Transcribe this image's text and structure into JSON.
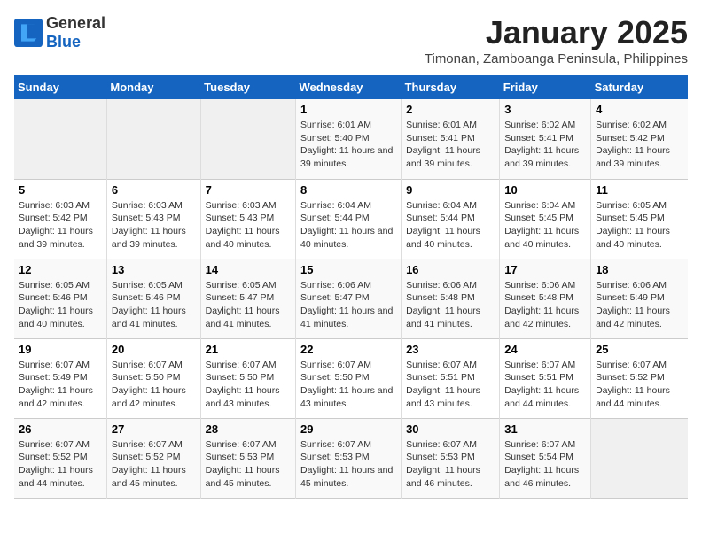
{
  "header": {
    "logo_general": "General",
    "logo_blue": "Blue",
    "month": "January 2025",
    "location": "Timonan, Zamboanga Peninsula, Philippines"
  },
  "weekdays": [
    "Sunday",
    "Monday",
    "Tuesday",
    "Wednesday",
    "Thursday",
    "Friday",
    "Saturday"
  ],
  "weeks": [
    [
      {
        "day": "",
        "empty": true
      },
      {
        "day": "",
        "empty": true
      },
      {
        "day": "",
        "empty": true
      },
      {
        "day": "1",
        "sunrise": "Sunrise: 6:01 AM",
        "sunset": "Sunset: 5:40 PM",
        "daylight": "Daylight: 11 hours and 39 minutes."
      },
      {
        "day": "2",
        "sunrise": "Sunrise: 6:01 AM",
        "sunset": "Sunset: 5:41 PM",
        "daylight": "Daylight: 11 hours and 39 minutes."
      },
      {
        "day": "3",
        "sunrise": "Sunrise: 6:02 AM",
        "sunset": "Sunset: 5:41 PM",
        "daylight": "Daylight: 11 hours and 39 minutes."
      },
      {
        "day": "4",
        "sunrise": "Sunrise: 6:02 AM",
        "sunset": "Sunset: 5:42 PM",
        "daylight": "Daylight: 11 hours and 39 minutes."
      }
    ],
    [
      {
        "day": "5",
        "sunrise": "Sunrise: 6:03 AM",
        "sunset": "Sunset: 5:42 PM",
        "daylight": "Daylight: 11 hours and 39 minutes."
      },
      {
        "day": "6",
        "sunrise": "Sunrise: 6:03 AM",
        "sunset": "Sunset: 5:43 PM",
        "daylight": "Daylight: 11 hours and 39 minutes."
      },
      {
        "day": "7",
        "sunrise": "Sunrise: 6:03 AM",
        "sunset": "Sunset: 5:43 PM",
        "daylight": "Daylight: 11 hours and 40 minutes."
      },
      {
        "day": "8",
        "sunrise": "Sunrise: 6:04 AM",
        "sunset": "Sunset: 5:44 PM",
        "daylight": "Daylight: 11 hours and 40 minutes."
      },
      {
        "day": "9",
        "sunrise": "Sunrise: 6:04 AM",
        "sunset": "Sunset: 5:44 PM",
        "daylight": "Daylight: 11 hours and 40 minutes."
      },
      {
        "day": "10",
        "sunrise": "Sunrise: 6:04 AM",
        "sunset": "Sunset: 5:45 PM",
        "daylight": "Daylight: 11 hours and 40 minutes."
      },
      {
        "day": "11",
        "sunrise": "Sunrise: 6:05 AM",
        "sunset": "Sunset: 5:45 PM",
        "daylight": "Daylight: 11 hours and 40 minutes."
      }
    ],
    [
      {
        "day": "12",
        "sunrise": "Sunrise: 6:05 AM",
        "sunset": "Sunset: 5:46 PM",
        "daylight": "Daylight: 11 hours and 40 minutes."
      },
      {
        "day": "13",
        "sunrise": "Sunrise: 6:05 AM",
        "sunset": "Sunset: 5:46 PM",
        "daylight": "Daylight: 11 hours and 41 minutes."
      },
      {
        "day": "14",
        "sunrise": "Sunrise: 6:05 AM",
        "sunset": "Sunset: 5:47 PM",
        "daylight": "Daylight: 11 hours and 41 minutes."
      },
      {
        "day": "15",
        "sunrise": "Sunrise: 6:06 AM",
        "sunset": "Sunset: 5:47 PM",
        "daylight": "Daylight: 11 hours and 41 minutes."
      },
      {
        "day": "16",
        "sunrise": "Sunrise: 6:06 AM",
        "sunset": "Sunset: 5:48 PM",
        "daylight": "Daylight: 11 hours and 41 minutes."
      },
      {
        "day": "17",
        "sunrise": "Sunrise: 6:06 AM",
        "sunset": "Sunset: 5:48 PM",
        "daylight": "Daylight: 11 hours and 42 minutes."
      },
      {
        "day": "18",
        "sunrise": "Sunrise: 6:06 AM",
        "sunset": "Sunset: 5:49 PM",
        "daylight": "Daylight: 11 hours and 42 minutes."
      }
    ],
    [
      {
        "day": "19",
        "sunrise": "Sunrise: 6:07 AM",
        "sunset": "Sunset: 5:49 PM",
        "daylight": "Daylight: 11 hours and 42 minutes."
      },
      {
        "day": "20",
        "sunrise": "Sunrise: 6:07 AM",
        "sunset": "Sunset: 5:50 PM",
        "daylight": "Daylight: 11 hours and 42 minutes."
      },
      {
        "day": "21",
        "sunrise": "Sunrise: 6:07 AM",
        "sunset": "Sunset: 5:50 PM",
        "daylight": "Daylight: 11 hours and 43 minutes."
      },
      {
        "day": "22",
        "sunrise": "Sunrise: 6:07 AM",
        "sunset": "Sunset: 5:50 PM",
        "daylight": "Daylight: 11 hours and 43 minutes."
      },
      {
        "day": "23",
        "sunrise": "Sunrise: 6:07 AM",
        "sunset": "Sunset: 5:51 PM",
        "daylight": "Daylight: 11 hours and 43 minutes."
      },
      {
        "day": "24",
        "sunrise": "Sunrise: 6:07 AM",
        "sunset": "Sunset: 5:51 PM",
        "daylight": "Daylight: 11 hours and 44 minutes."
      },
      {
        "day": "25",
        "sunrise": "Sunrise: 6:07 AM",
        "sunset": "Sunset: 5:52 PM",
        "daylight": "Daylight: 11 hours and 44 minutes."
      }
    ],
    [
      {
        "day": "26",
        "sunrise": "Sunrise: 6:07 AM",
        "sunset": "Sunset: 5:52 PM",
        "daylight": "Daylight: 11 hours and 44 minutes."
      },
      {
        "day": "27",
        "sunrise": "Sunrise: 6:07 AM",
        "sunset": "Sunset: 5:52 PM",
        "daylight": "Daylight: 11 hours and 45 minutes."
      },
      {
        "day": "28",
        "sunrise": "Sunrise: 6:07 AM",
        "sunset": "Sunset: 5:53 PM",
        "daylight": "Daylight: 11 hours and 45 minutes."
      },
      {
        "day": "29",
        "sunrise": "Sunrise: 6:07 AM",
        "sunset": "Sunset: 5:53 PM",
        "daylight": "Daylight: 11 hours and 45 minutes."
      },
      {
        "day": "30",
        "sunrise": "Sunrise: 6:07 AM",
        "sunset": "Sunset: 5:53 PM",
        "daylight": "Daylight: 11 hours and 46 minutes."
      },
      {
        "day": "31",
        "sunrise": "Sunrise: 6:07 AM",
        "sunset": "Sunset: 5:54 PM",
        "daylight": "Daylight: 11 hours and 46 minutes."
      },
      {
        "day": "",
        "empty": true
      }
    ]
  ]
}
